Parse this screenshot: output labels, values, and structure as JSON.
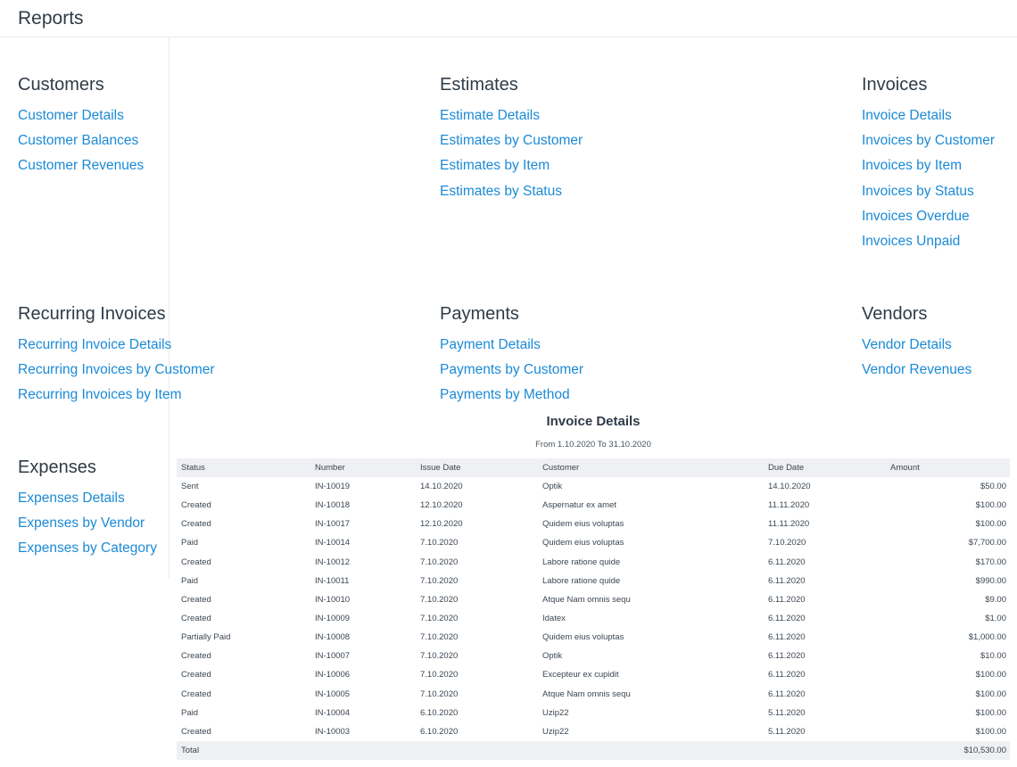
{
  "header": {
    "title": "Reports"
  },
  "sections": {
    "customers": {
      "title": "Customers",
      "links": [
        "Customer Details",
        "Customer Balances",
        "Customer Revenues"
      ]
    },
    "estimates": {
      "title": "Estimates",
      "links": [
        "Estimate Details",
        "Estimates by Customer",
        "Estimates by Item",
        "Estimates by Status"
      ]
    },
    "invoices": {
      "title": "Invoices",
      "links": [
        "Invoice Details",
        "Invoices by Customer",
        "Invoices by Item",
        "Invoices by Status",
        "Invoices Overdue",
        "Invoices Unpaid"
      ]
    },
    "recurring": {
      "title": "Recurring Invoices",
      "links": [
        "Recurring Invoice Details",
        "Recurring Invoices by Customer",
        "Recurring Invoices by Item"
      ]
    },
    "payments": {
      "title": "Payments",
      "links": [
        "Payment Details",
        "Payments by Customer",
        "Payments by Method"
      ]
    },
    "vendors": {
      "title": "Vendors",
      "links": [
        "Vendor Details",
        "Vendor Revenues"
      ]
    },
    "expenses": {
      "title": "Expenses",
      "links": [
        "Expenses Details",
        "Expenses by Vendor",
        "Expenses by Category"
      ]
    }
  },
  "report": {
    "title": "Invoice Details",
    "range": "From 1.10.2020 To 31.10.2020",
    "columns": [
      "Status",
      "Number",
      "Issue Date",
      "Customer",
      "Due Date",
      "Amount"
    ],
    "rows": [
      [
        "Sent",
        "IN-10019",
        "14.10.2020",
        "Optik",
        "14.10.2020",
        "$50.00"
      ],
      [
        "Created",
        "IN-10018",
        "12.10.2020",
        "Aspernatur ex amet",
        "11.11.2020",
        "$100.00"
      ],
      [
        "Created",
        "IN-10017",
        "12.10.2020",
        "Quidem eius voluptas",
        "11.11.2020",
        "$100.00"
      ],
      [
        "Paid",
        "IN-10014",
        "7.10.2020",
        "Quidem eius voluptas",
        "7.10.2020",
        "$7,700.00"
      ],
      [
        "Created",
        "IN-10012",
        "7.10.2020",
        "Labore ratione quide",
        "6.11.2020",
        "$170.00"
      ],
      [
        "Paid",
        "IN-10011",
        "7.10.2020",
        "Labore ratione quide",
        "6.11.2020",
        "$990.00"
      ],
      [
        "Created",
        "IN-10010",
        "7.10.2020",
        "Atque Nam omnis sequ",
        "6.11.2020",
        "$9.00"
      ],
      [
        "Created",
        "IN-10009",
        "7.10.2020",
        "Idatex",
        "6.11.2020",
        "$1.00"
      ],
      [
        "Partially Paid",
        "IN-10008",
        "7.10.2020",
        "Quidem eius voluptas",
        "6.11.2020",
        "$1,000.00"
      ],
      [
        "Created",
        "IN-10007",
        "7.10.2020",
        "Optik",
        "6.11.2020",
        "$10.00"
      ],
      [
        "Created",
        "IN-10006",
        "7.10.2020",
        "Excepteur ex cupidit",
        "6.11.2020",
        "$100.00"
      ],
      [
        "Created",
        "IN-10005",
        "7.10.2020",
        "Atque Nam omnis sequ",
        "6.11.2020",
        "$100.00"
      ],
      [
        "Paid",
        "IN-10004",
        "6.10.2020",
        "Uzip22",
        "5.11.2020",
        "$100.00"
      ],
      [
        "Created",
        "IN-10003",
        "6.10.2020",
        "Uzip22",
        "5.11.2020",
        "$100.00"
      ]
    ],
    "total_label": "Total",
    "total_value": "$10,530.00"
  }
}
